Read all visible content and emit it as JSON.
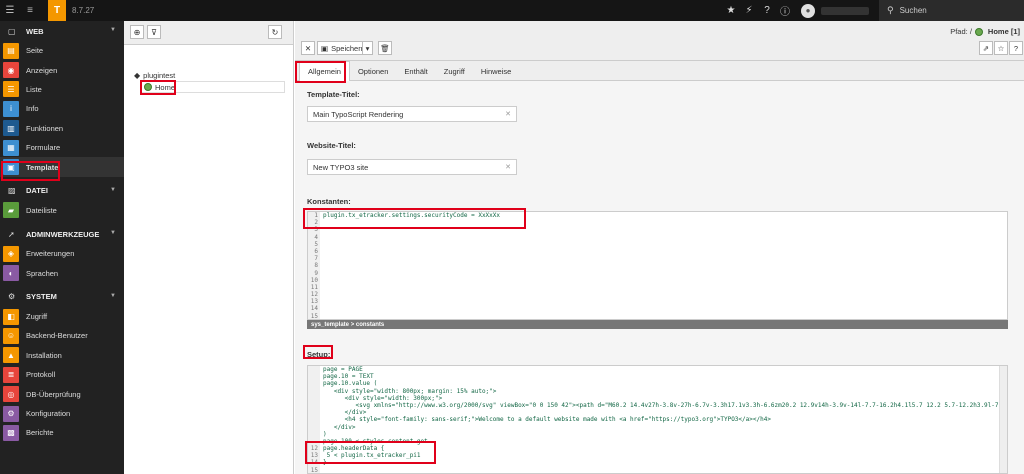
{
  "topbar": {
    "version": "8.7.27",
    "search_label": "Suchen"
  },
  "sidebar": {
    "sections": [
      {
        "label": "WEB",
        "items": [
          "Seite",
          "Anzeigen",
          "Liste",
          "Info",
          "Funktionen",
          "Formulare",
          "Template"
        ]
      },
      {
        "label": "DATEI",
        "items": [
          "Dateiliste"
        ]
      },
      {
        "label": "ADMINWERKZEUGE",
        "items": [
          "Erweiterungen",
          "Sprachen"
        ]
      },
      {
        "label": "SYSTEM",
        "items": [
          "Zugriff",
          "Backend-Benutzer",
          "Installation",
          "Protokoll",
          "DB-Überprüfung",
          "Konfiguration",
          "Berichte"
        ]
      }
    ],
    "colors": {
      "seite": "#f49700",
      "anzeigen": "#e8453c",
      "liste": "#f49700",
      "info": "#3d8fd1",
      "funktionen": "#1e5a8f",
      "formulare": "#3d8fd1",
      "template": "#3d8fd1",
      "dateiliste": "#5a9c3b",
      "erweiterungen": "#f49700",
      "sprachen": "#8a5aa3",
      "zugriff": "#f49700",
      "backend": "#f49700",
      "installation": "#f49700",
      "protokoll": "#e8453c",
      "db": "#e8453c",
      "konfiguration": "#8a5aa3",
      "berichte": "#8a5aa3"
    }
  },
  "tree": {
    "root_label": "plugintest",
    "home_label": "Home"
  },
  "header": {
    "path_label": "Pfad: /",
    "path_page": "Home [1]",
    "save_label": "Speichern"
  },
  "tabs": [
    "Allgemein",
    "Optionen",
    "Enthält",
    "Zugriff",
    "Hinweise"
  ],
  "form": {
    "template_title_label": "Template-Titel:",
    "template_title_value": "Main TypoScript Rendering",
    "website_title_label": "Website-Titel:",
    "website_title_value": "New TYPO3 site",
    "constants_label": "Konstanten:",
    "constants_lines": [
      "plugin.tx_etracker.settings.securityCode = XxXxXx",
      "",
      "",
      "",
      "",
      "",
      "",
      "",
      "",
      "",
      "",
      "",
      "",
      "",
      ""
    ],
    "constants_footer": "sys_template > constants",
    "setup_label": "Setup:",
    "setup_lines": [
      "page = PAGE",
      "page.10 = TEXT",
      "page.10.value (",
      "   <div style=\"width: 800px; margin: 15% auto;\">",
      "      <div style=\"width: 300px;\">",
      "         <svg xmlns=\"http://www.w3.org/2000/svg\" viewBox=\"0 0 150 42\"><path d=\"M60.2 14.4v27h-3.8v-27h-6.7v-3.3h17.1v3.3h-6.6zm20.2 12.9v14h-3.9v-14l-7.7-16.2h4.1l5.7 12.2 5.7-12.2h3.9l-7.8 16",
      "      </div>",
      "      <h4 style=\"font-family: sans-serif;\">Welcome to a default website made with <a href=\"https://typo3.org\">TYPO3</a></h4>",
      "   </div>",
      ")",
      "page.100 < styles.content.get",
      "page.headerData {",
      " 5 < plugin.tx_etracker_pi1",
      "}",
      ""
    ],
    "setup_line_numbers": [
      "",
      "",
      "",
      "",
      "",
      "",
      "",
      "",
      "",
      "",
      "",
      "12",
      "13",
      "14",
      "15"
    ]
  }
}
